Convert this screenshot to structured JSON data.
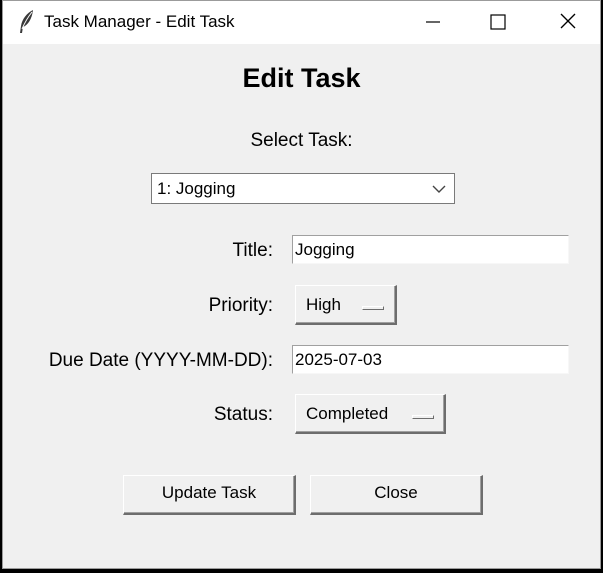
{
  "window": {
    "title": "Task Manager - Edit Task",
    "icon": "feather-icon",
    "controls": [
      "minimize-icon",
      "maximize-icon",
      "close-icon"
    ]
  },
  "form": {
    "heading": "Edit Task",
    "select_task_label": "Select Task:",
    "select_task_value": "1: Jogging",
    "title_label": "Title:",
    "title_value": "Jogging",
    "priority_label": "Priority:",
    "priority_value": "High",
    "due_date_label": "Due Date (YYYY-MM-DD):",
    "due_date_value": "2025-07-03",
    "status_label": "Status:",
    "status_value": "Completed"
  },
  "buttons": {
    "update": "Update Task",
    "close": "Close"
  }
}
